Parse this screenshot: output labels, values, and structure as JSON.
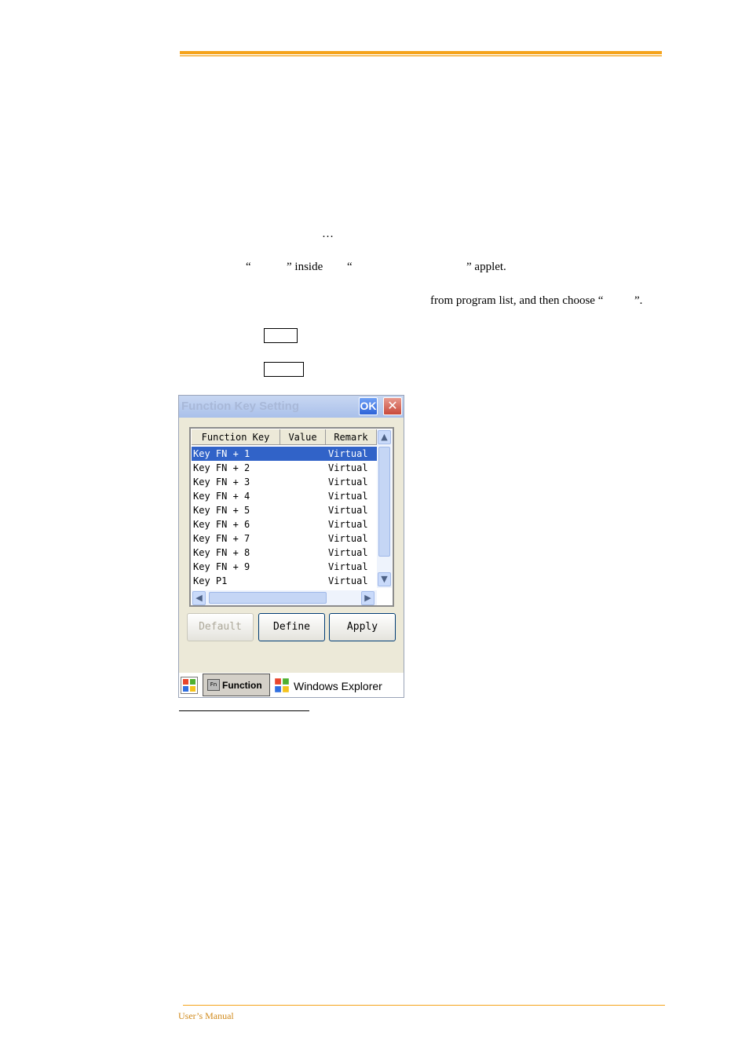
{
  "doc": {
    "ellipsis": "…",
    "line1_a": "“",
    "line1_b": "” inside",
    "line1_c": "“",
    "line1_d": "” applet.",
    "line2": "from program list, and then choose “",
    "line2_end": "”.",
    "footer": "User’s Manual"
  },
  "window": {
    "title": "Function Key Setting",
    "ok_label": "OK",
    "close_label": "✕",
    "columns": [
      "Function Key",
      "Value",
      "Remark"
    ],
    "rows": [
      {
        "key": "Key FN + 1",
        "value": "",
        "remark": "Virtual",
        "selected": true
      },
      {
        "key": "Key FN + 2",
        "value": "",
        "remark": "Virtual",
        "selected": false
      },
      {
        "key": "Key FN + 3",
        "value": "",
        "remark": "Virtual",
        "selected": false
      },
      {
        "key": "Key FN + 4",
        "value": "",
        "remark": "Virtual",
        "selected": false
      },
      {
        "key": "Key FN + 5",
        "value": "",
        "remark": "Virtual",
        "selected": false
      },
      {
        "key": "Key FN + 6",
        "value": "",
        "remark": "Virtual",
        "selected": false
      },
      {
        "key": "Key FN + 7",
        "value": "",
        "remark": "Virtual",
        "selected": false
      },
      {
        "key": "Key FN + 8",
        "value": "",
        "remark": "Virtual",
        "selected": false
      },
      {
        "key": "Key FN + 9",
        "value": "",
        "remark": "Virtual",
        "selected": false
      },
      {
        "key": "Key P1",
        "value": "",
        "remark": "Virtual",
        "selected": false
      }
    ],
    "buttons": {
      "default": "Default",
      "define": "Define",
      "apply": "Apply"
    }
  },
  "taskbar": {
    "function_label": "Function",
    "fn_icon_text": "Fn",
    "explorer_label": "Windows Explorer"
  },
  "colors": {
    "accent": "#f5a31a",
    "selection": "#3163c8"
  }
}
